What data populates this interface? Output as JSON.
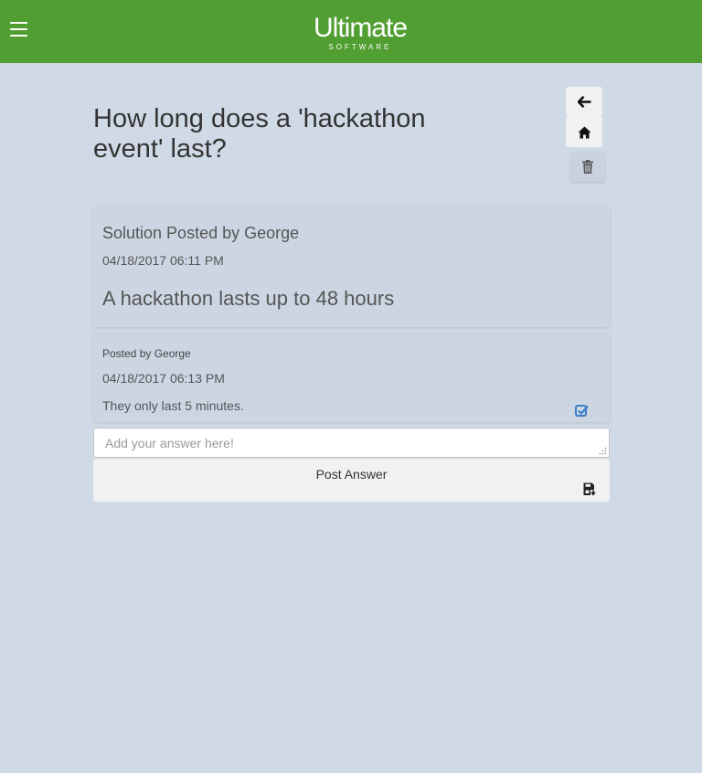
{
  "header": {
    "menu_icon": "hamburger-icon",
    "logo_main": "Ultimate",
    "logo_sub": "SOFTWARE",
    "brand_color": "#519e33"
  },
  "question": {
    "title": "How long does a 'hackathon event' last?"
  },
  "actions": {
    "back_icon": "arrow-left-icon",
    "home_icon": "home-icon",
    "delete_icon": "trash-icon"
  },
  "solution": {
    "header": "Solution Posted by George",
    "date": "04/18/2017 06:11 PM",
    "body": "A hackathon lasts up to 48 hours"
  },
  "comments": [
    {
      "header": "Posted by George",
      "date": "04/18/2017 06:13 PM",
      "body": "They only last 5 minutes.",
      "accept_icon": "check-square-icon",
      "accent_color": "#3b7fc4"
    }
  ],
  "answer_form": {
    "placeholder": "Add your answer here!",
    "value": "",
    "submit_label": "Post Answer",
    "submit_icon": "save-icon"
  }
}
